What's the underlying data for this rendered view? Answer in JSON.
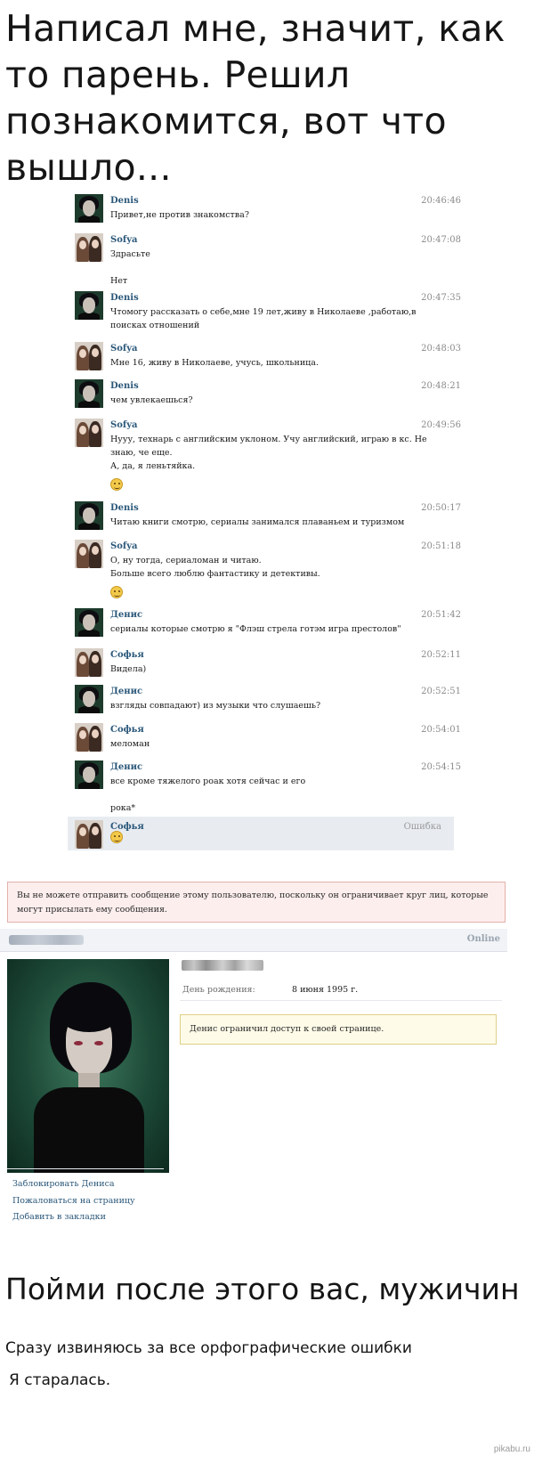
{
  "headline": {
    "lines": [
      "Написал мне, значит, как",
      "то парень. Решил",
      "познакомится, вот что",
      "вышло..."
    ]
  },
  "chat": {
    "messages": [
      {
        "sender": "Denis",
        "avatar": "denis",
        "time": "20:46:46",
        "lines": [
          "Привет,не против знакомства?"
        ]
      },
      {
        "sender": "Sofya",
        "avatar": "sofya",
        "time": "20:47:08",
        "lines": [
          "Здрасьте",
          "",
          "Нет"
        ]
      },
      {
        "sender": "Denis",
        "avatar": "denis",
        "time": "20:47:35",
        "lines": [
          "Чтомогу рассказать о себе,мне 19 лет,живу в Николаеве ,работаю,в",
          "поисках отношений"
        ]
      },
      {
        "sender": "Sofya",
        "avatar": "sofya",
        "time": "20:48:03",
        "lines": [
          "Мне 16, живу в Николаеве, учусь, школьница."
        ]
      },
      {
        "sender": "Denis",
        "avatar": "denis",
        "time": "20:48:21",
        "lines": [
          "чем увлекаешься?"
        ]
      },
      {
        "sender": "Sofya",
        "avatar": "sofya",
        "time": "20:49:56",
        "lines": [
          "Нууу, технарь с английским уклоном. Учу английский, играю в кс. Не",
          "знаю, че еще.",
          "А, да, я леньтяйка."
        ],
        "emoji": "laughing-emoji"
      },
      {
        "sender": "Denis",
        "avatar": "denis",
        "time": "20:50:17",
        "lines": [
          "Читаю книги смотрю, сериалы занимался плаваньем и туризмом"
        ]
      },
      {
        "sender": "Sofya",
        "avatar": "sofya",
        "time": "20:51:18",
        "lines": [
          "О, ну тогда, сериаломан и читаю.",
          "Больше всего люблю фантастику и детективы."
        ],
        "emoji": "smile-emoji"
      },
      {
        "sender": "Денис",
        "avatar": "denis",
        "time": "20:51:42",
        "lines": [
          "сериалы которые смотрю я \"Флэш стрела готэм игра престолов\""
        ]
      },
      {
        "sender": "Софья",
        "avatar": "sofya",
        "time": "20:52:11",
        "lines": [
          "Видела)"
        ]
      },
      {
        "sender": "Денис",
        "avatar": "denis",
        "time": "20:52:51",
        "lines": [
          "взгляды совпадают) из музыки что слушаешь?"
        ]
      },
      {
        "sender": "Софья",
        "avatar": "sofya",
        "time": "20:54:01",
        "lines": [
          "меломан"
        ]
      },
      {
        "sender": "Денис",
        "avatar": "denis",
        "time": "20:54:15",
        "lines": [
          "все кроме тяжелого роак хотя сейчас и его",
          "",
          "рока*"
        ]
      }
    ],
    "failed": {
      "sender": "Софья",
      "avatar": "sofya",
      "status": "Ошибка",
      "emoji": "smile-emoji"
    }
  },
  "notice": {
    "text": "Вы не можете отправить сообщение этому пользователю, поскольку он ограничивает круг лиц, которые могут присылать ему сообщения."
  },
  "profile": {
    "online_label": "Online",
    "birthday_label": "День рождения:",
    "birthday_value": "8 июня 1995 г.",
    "restricted_text": "Денис ограничил доступ к своей странице.",
    "actions": [
      "Заблокировать Дениса",
      "Пожаловаться на страницу",
      "Добавить в закладки"
    ]
  },
  "bottom_title": "Пойми после этого вас, мужичин",
  "footer": {
    "line1": "Сразу извиняюсь за все орфографические ошибки",
    "line2": "Я старалась."
  },
  "watermark": "pikabu.ru"
}
